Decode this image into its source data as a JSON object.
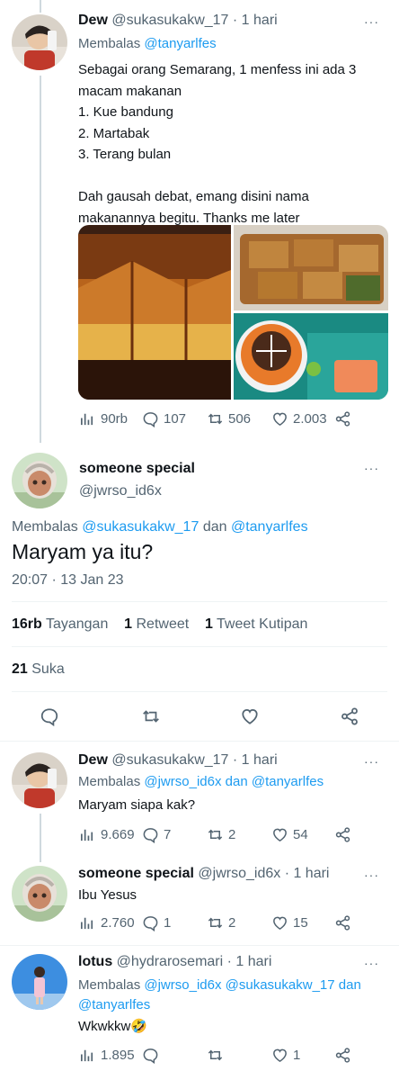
{
  "tweet1": {
    "display_name": "Dew",
    "handle": "@sukasukakw_17",
    "time": "· 1 hari",
    "reply_label": "Membalas",
    "reply_to": "@tanyarlfes",
    "text_lines": [
      "Sebagai orang Semarang, 1 menfess ini ada 3",
      "macam makanan",
      "1. Kue bandung",
      "2. Martabak",
      "3. Terang bulan",
      "",
      "Dah gausah debat, emang disini nama",
      "makanannya begitu. Thanks me later"
    ],
    "views": "90rb",
    "replies": "107",
    "retweets": "506",
    "likes": "2.003"
  },
  "main_tweet": {
    "display_name": "someone special",
    "handle": "@jwrso_id6x",
    "reply_label": "Membalas",
    "reply_to_1": "@sukasukakw_17",
    "reply_and": "dan",
    "reply_to_2": "@tanyarlfes",
    "text": "Maryam ya itu?",
    "timestamp": "20:07 · 13 Jan 23",
    "views_count": "16rb",
    "views_label": "Tayangan",
    "retweet_count": "1",
    "retweet_label": "Retweet",
    "quote_count": "1",
    "quote_label": "Tweet Kutipan",
    "likes_count": "21",
    "likes_label": "Suka"
  },
  "reply1": {
    "display_name": "Dew",
    "handle": "@sukasukakw_17",
    "time": "· 1 hari",
    "reply_label": "Membalas",
    "reply_to_1": "@jwrso_id6x",
    "reply_and": "dan",
    "reply_to_2": "@tanyarlfes",
    "text": "Maryam siapa kak?",
    "views": "9.669",
    "replies": "7",
    "retweets": "2",
    "likes": "54"
  },
  "reply2": {
    "display_name": "someone special",
    "handle": "@jwrso_id6x",
    "time": "· 1 hari",
    "text": "Ibu Yesus",
    "views": "2.760",
    "replies": "1",
    "retweets": "2",
    "likes": "15"
  },
  "reply3": {
    "display_name": "lotus",
    "handle": "@hydrarosemari",
    "time": "· 1 hari",
    "reply_label": "Membalas",
    "reply_to_1": "@jwrso_id6x",
    "reply_to_2": "@sukasukakw_17",
    "reply_and": "dan",
    "reply_to_3": "@tanyarlfes",
    "text": "Wkwkkw🤣",
    "views": "1.895",
    "likes": "1"
  },
  "more_label": "···",
  "colors": {
    "accent": "#1d9bf0",
    "muted": "#536471",
    "border": "#eff3f4"
  }
}
